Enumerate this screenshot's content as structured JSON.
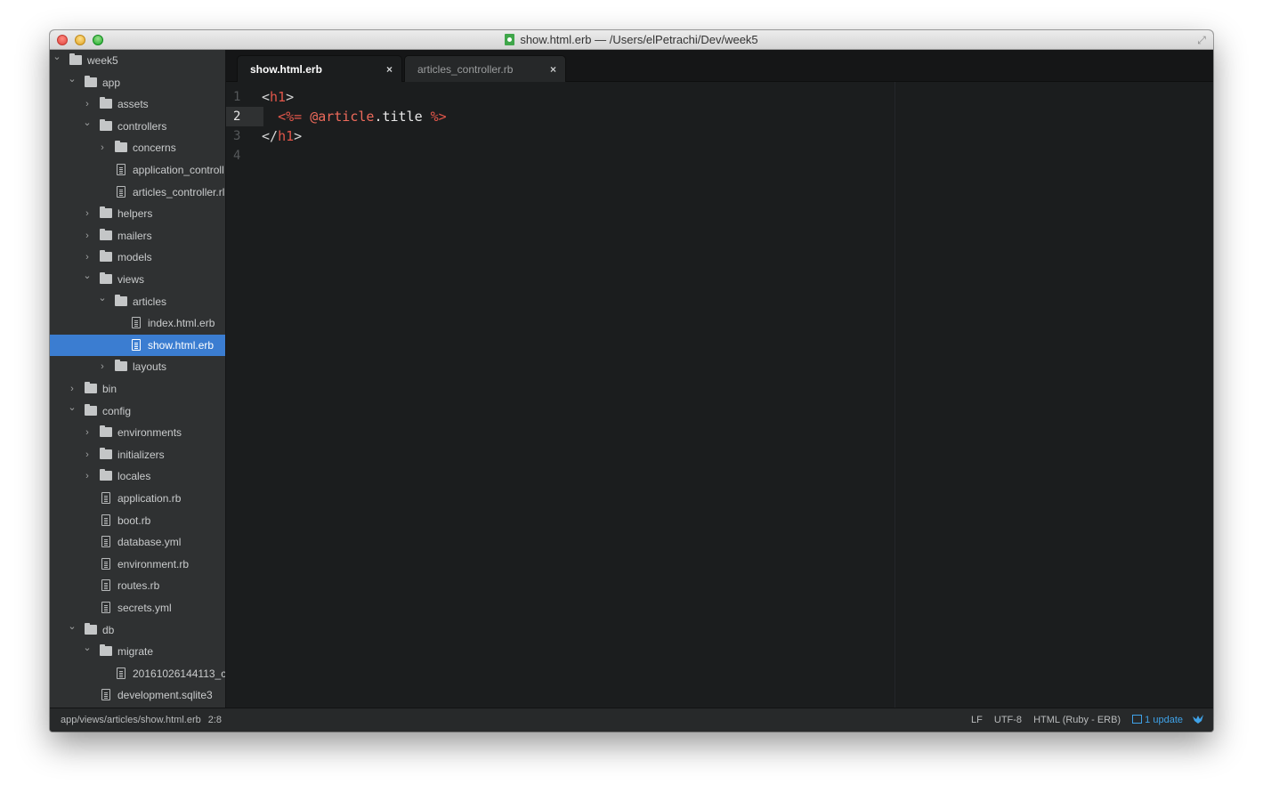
{
  "window": {
    "title": "show.html.erb — /Users/elPetrachi/Dev/week5"
  },
  "sidebar": {
    "items": [
      {
        "label": "week5",
        "type": "folder",
        "expanded": true,
        "depth": 0
      },
      {
        "label": "app",
        "type": "folder",
        "expanded": true,
        "depth": 1
      },
      {
        "label": "assets",
        "type": "folder",
        "expanded": false,
        "depth": 2
      },
      {
        "label": "controllers",
        "type": "folder",
        "expanded": true,
        "depth": 2
      },
      {
        "label": "concerns",
        "type": "folder",
        "expanded": false,
        "depth": 3
      },
      {
        "label": "application_controll",
        "type": "file",
        "depth": 3
      },
      {
        "label": "articles_controller.rl",
        "type": "file",
        "depth": 3
      },
      {
        "label": "helpers",
        "type": "folder",
        "expanded": false,
        "depth": 2
      },
      {
        "label": "mailers",
        "type": "folder",
        "expanded": false,
        "depth": 2
      },
      {
        "label": "models",
        "type": "folder",
        "expanded": false,
        "depth": 2
      },
      {
        "label": "views",
        "type": "folder",
        "expanded": true,
        "depth": 2
      },
      {
        "label": "articles",
        "type": "folder",
        "expanded": true,
        "depth": 3
      },
      {
        "label": "index.html.erb",
        "type": "file",
        "depth": 4
      },
      {
        "label": "show.html.erb",
        "type": "file",
        "depth": 4,
        "selected": true
      },
      {
        "label": "layouts",
        "type": "folder",
        "expanded": false,
        "depth": 3
      },
      {
        "label": "bin",
        "type": "folder",
        "expanded": false,
        "depth": 1
      },
      {
        "label": "config",
        "type": "folder",
        "expanded": true,
        "depth": 1
      },
      {
        "label": "environments",
        "type": "folder",
        "expanded": false,
        "depth": 2
      },
      {
        "label": "initializers",
        "type": "folder",
        "expanded": false,
        "depth": 2
      },
      {
        "label": "locales",
        "type": "folder",
        "expanded": false,
        "depth": 2
      },
      {
        "label": "application.rb",
        "type": "file",
        "depth": 2
      },
      {
        "label": "boot.rb",
        "type": "file",
        "depth": 2
      },
      {
        "label": "database.yml",
        "type": "file",
        "depth": 2
      },
      {
        "label": "environment.rb",
        "type": "file",
        "depth": 2
      },
      {
        "label": "routes.rb",
        "type": "file",
        "depth": 2
      },
      {
        "label": "secrets.yml",
        "type": "file",
        "depth": 2
      },
      {
        "label": "db",
        "type": "folder",
        "expanded": true,
        "depth": 1
      },
      {
        "label": "migrate",
        "type": "folder",
        "expanded": true,
        "depth": 2
      },
      {
        "label": "20161026144113_c",
        "type": "file",
        "depth": 3
      },
      {
        "label": "development.sqlite3",
        "type": "file",
        "depth": 2
      }
    ]
  },
  "tabs": [
    {
      "label": "show.html.erb",
      "close": "×",
      "active": true
    },
    {
      "label": "articles_controller.rb",
      "close": "×",
      "active": false
    }
  ],
  "editor": {
    "cursor_line": 2,
    "lines": [
      {
        "number": "1",
        "tokens": [
          [
            "t-punct",
            "<"
          ],
          [
            "t-tag",
            "h1"
          ],
          [
            "t-punct",
            ">"
          ]
        ]
      },
      {
        "number": "2",
        "tokens": [
          [
            "t-punct",
            "  "
          ],
          [
            "t-erb",
            "<%="
          ],
          [
            "t-punct",
            " "
          ],
          [
            "t-ivar",
            "@article"
          ],
          [
            "t-method",
            ".title"
          ],
          [
            "t-punct",
            " "
          ],
          [
            "t-erb",
            "%>"
          ]
        ]
      },
      {
        "number": "3",
        "tokens": [
          [
            "t-punct",
            "</"
          ],
          [
            "t-tag",
            "h1"
          ],
          [
            "t-punct",
            ">"
          ]
        ]
      },
      {
        "number": "4",
        "tokens": []
      }
    ]
  },
  "statusbar": {
    "path": "app/views/articles/show.html.erb",
    "position": "2:8",
    "line_ending": "LF",
    "encoding": "UTF-8",
    "grammar": "HTML (Ruby - ERB)",
    "update": "1 update"
  },
  "colors": {
    "selected": "#3b7dd1",
    "tag": "#e2564a",
    "update": "#3fa2e8"
  }
}
